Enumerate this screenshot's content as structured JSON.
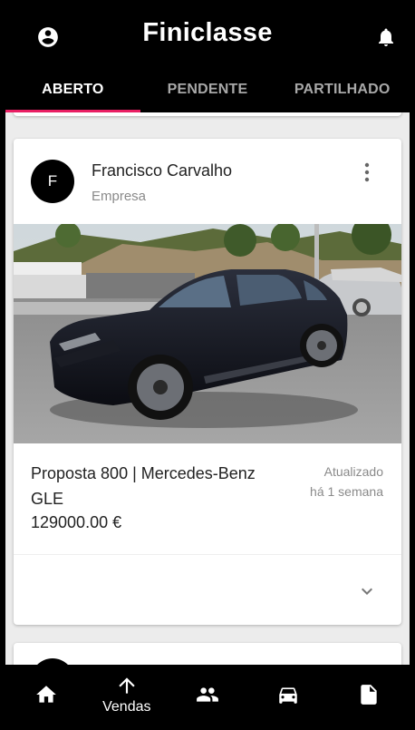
{
  "app": {
    "brand": "Finiclasse"
  },
  "header": {
    "account_icon": "account-circle-icon",
    "notifications_icon": "bell-icon"
  },
  "tabs": [
    {
      "label": "ABERTO",
      "active": true
    },
    {
      "label": "PENDENTE",
      "active": false
    },
    {
      "label": "PARTILHADO",
      "active": false
    }
  ],
  "colors": {
    "accent": "#e91e63",
    "appbar": "#000000",
    "background": "#ececec"
  },
  "listing": {
    "avatar_letter": "F",
    "poster_name": "Francisco Carvalho",
    "poster_role": "Empresa",
    "title": "Proposta 800 | Mercedes-Benz GLE",
    "price": "129000.00 €",
    "updated_line1": "Atualizado",
    "updated_line2": "há 1 semana",
    "menu_icon": "more-vert-icon",
    "expand_icon": "chevron-down-icon",
    "photo_icon": "car-photo"
  },
  "bottom_nav": [
    {
      "icon": "home-icon",
      "label": ""
    },
    {
      "icon": "arrow-up-icon",
      "label": "Vendas"
    },
    {
      "icon": "people-icon",
      "label": ""
    },
    {
      "icon": "car-icon",
      "label": ""
    },
    {
      "icon": "document-icon",
      "label": ""
    }
  ]
}
